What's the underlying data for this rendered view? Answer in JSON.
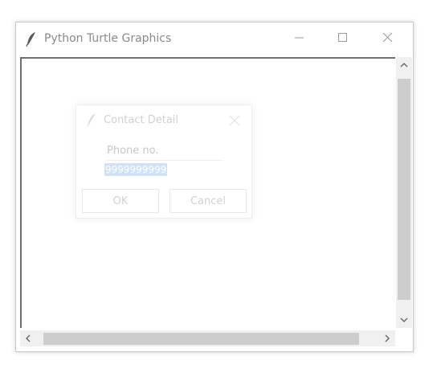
{
  "window": {
    "title": "Python Turtle Graphics",
    "icon": "feather-icon",
    "controls": [
      "minimize-icon",
      "maximize-icon",
      "close-icon"
    ]
  },
  "dialog": {
    "title": "Contact Detail",
    "icon": "feather-icon",
    "field_label": "Phone no.",
    "field_value": "9999999999",
    "ok_label": "OK",
    "cancel_label": "Cancel"
  },
  "colors": {
    "selection": "#cfe2f7",
    "scrollbar_thumb": "#cdcdcd"
  }
}
